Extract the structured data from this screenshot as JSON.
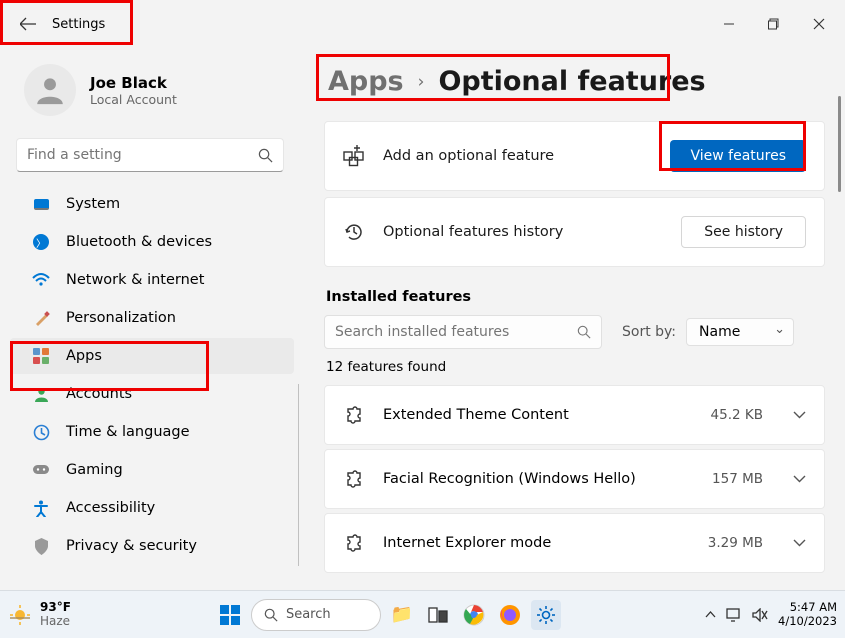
{
  "titlebar": {
    "label": "Settings"
  },
  "profile": {
    "name": "Joe Black",
    "account_type": "Local Account"
  },
  "search": {
    "placeholder": "Find a setting"
  },
  "sidebar": {
    "items": [
      {
        "label": "System"
      },
      {
        "label": "Bluetooth & devices"
      },
      {
        "label": "Network & internet"
      },
      {
        "label": "Personalization"
      },
      {
        "label": "Apps"
      },
      {
        "label": "Accounts"
      },
      {
        "label": "Time & language"
      },
      {
        "label": "Gaming"
      },
      {
        "label": "Accessibility"
      },
      {
        "label": "Privacy & security"
      }
    ]
  },
  "breadcrumb": {
    "parent": "Apps",
    "current": "Optional features"
  },
  "add_card": {
    "label": "Add an optional feature",
    "button": "View features"
  },
  "history_card": {
    "label": "Optional features history",
    "button": "See history"
  },
  "installed": {
    "heading": "Installed features",
    "search_placeholder": "Search installed features",
    "sort_label": "Sort by:",
    "sort_value": "Name",
    "count_text": "12 features found",
    "items": [
      {
        "name": "Extended Theme Content",
        "size": "45.2 KB"
      },
      {
        "name": "Facial Recognition (Windows Hello)",
        "size": "157 MB"
      },
      {
        "name": "Internet Explorer mode",
        "size": "3.29 MB"
      }
    ]
  },
  "taskbar": {
    "weather_temp": "93°F",
    "weather_cond": "Haze",
    "search": "Search",
    "time": "5:47 AM",
    "date": "4/10/2023"
  }
}
